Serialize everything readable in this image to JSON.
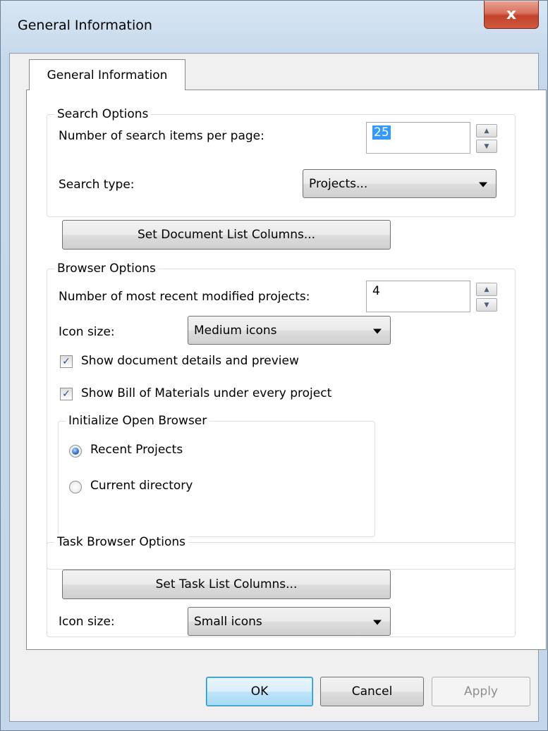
{
  "window": {
    "title": "General Information",
    "close_label": "x"
  },
  "tab": {
    "label": "General Information"
  },
  "search_options": {
    "legend": "Search Options",
    "items_per_page_label": "Number of search items per page:",
    "items_per_page_value": "25",
    "search_type_label": "Search type:",
    "search_type_value": "Projects..."
  },
  "set_document_list_columns_label": "Set Document List Columns...",
  "browser_options": {
    "legend": "Browser Options",
    "recent_projects_label": "Number of most recent modified projects:",
    "recent_projects_value": "4",
    "icon_size_label": "Icon size:",
    "icon_size_value": "Medium icons",
    "show_details_label": "Show document details and preview",
    "show_details_checked": true,
    "show_bom_label": "Show Bill of Materials under every project",
    "show_bom_checked": true,
    "init_open_browser": {
      "legend": "Initialize Open Browser",
      "options": [
        "Recent Projects",
        "Current directory"
      ],
      "selected": "Recent Projects"
    }
  },
  "task_browser_options": {
    "legend": "Task Browser Options",
    "set_task_list_columns_label": "Set Task List Columns...",
    "icon_size_label": "Icon size:",
    "icon_size_value": "Small icons"
  },
  "footer": {
    "ok_label": "OK",
    "cancel_label": "Cancel",
    "apply_label": "Apply"
  },
  "glyphs": {
    "check": "✓",
    "spin_up": "▲",
    "spin_down": "▼"
  },
  "colors": {
    "selection": "#3399ff",
    "close_button": "#c2412b",
    "default_button_border": "#3c7fb1"
  }
}
